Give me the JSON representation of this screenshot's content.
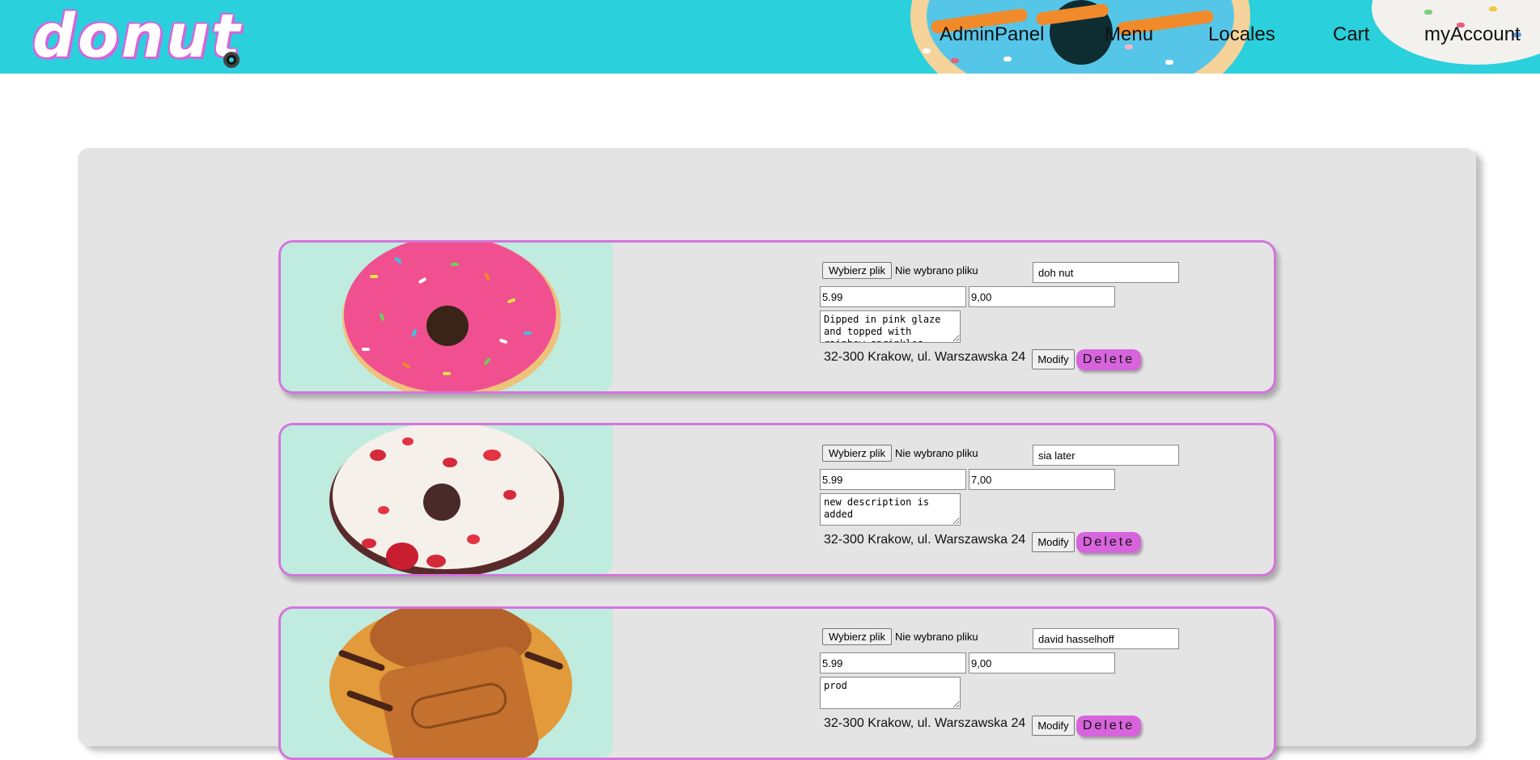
{
  "header": {
    "logo_text": "donut",
    "nav": [
      {
        "label": "AdminPanel"
      },
      {
        "label": "Menu"
      },
      {
        "label": "Locales"
      },
      {
        "label": "Cart"
      },
      {
        "label": "myAccount"
      }
    ]
  },
  "products": [
    {
      "image_icon": "pink-sprinkle-donut",
      "file_button": "Wybierz plik",
      "file_status": "Nie wybrano pliku",
      "name": "doh nut",
      "price": "5.99",
      "price_alt": "9,00",
      "description": "Dipped in pink glaze and topped with rainbow sprinkles",
      "address": "32-300 Krakow, ul. Warszawska 24",
      "modify_label": "Modify",
      "delete_label": "Delete"
    },
    {
      "image_icon": "red-velvet-donut",
      "file_button": "Wybierz plik",
      "file_status": "Nie wybrano pliku",
      "name": "sia later",
      "price": "5.99",
      "price_alt": "7,00",
      "description": "new description is added",
      "address": "32-300 Krakow, ul. Warszawska 24",
      "modify_label": "Modify",
      "delete_label": "Delete"
    },
    {
      "image_icon": "lotus-biscoff-donut",
      "file_button": "Wybierz plik",
      "file_status": "Nie wybrano pliku",
      "name": "david hasselhoff",
      "price": "5.99",
      "price_alt": "9,00",
      "description": "prod",
      "address": "32-300 Krakow, ul. Warszawska 24",
      "modify_label": "Modify",
      "delete_label": "Delete"
    }
  ],
  "colors": {
    "header_bg": "#2ad0dc",
    "accent": "#d764dc",
    "panel_bg": "#e4e4e4"
  }
}
